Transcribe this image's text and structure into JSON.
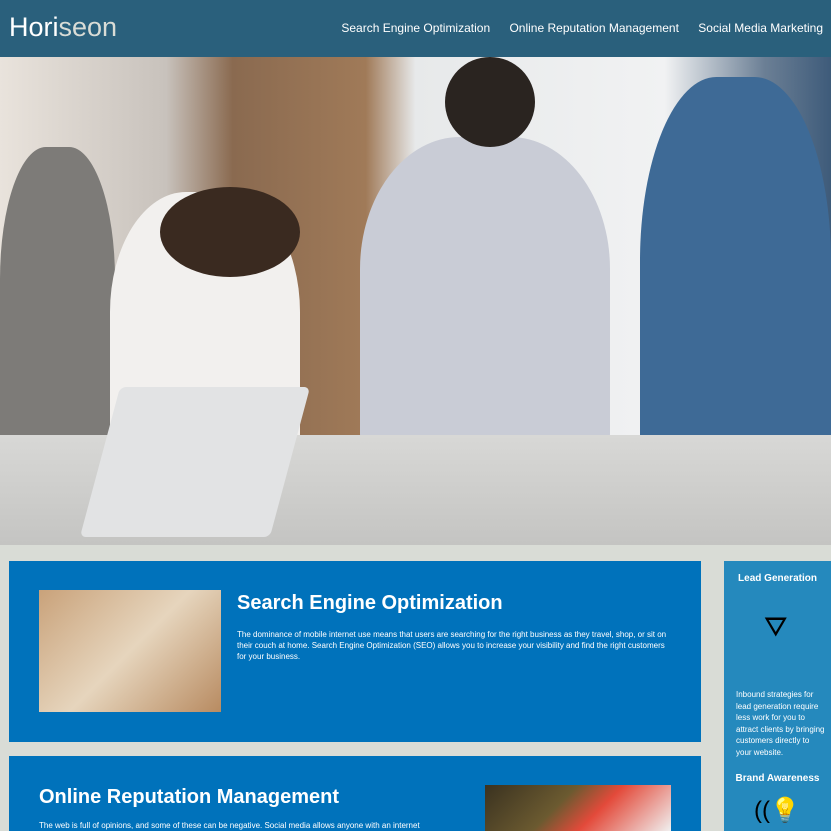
{
  "header": {
    "logo_main": "Hori",
    "logo_accent": "seon",
    "nav": [
      "Search Engine Optimization",
      "Online Reputation Management",
      "Social Media Marketing"
    ]
  },
  "hero": {
    "alt": "team meeting photo"
  },
  "content": [
    {
      "title": "Search Engine Optimization",
      "text": "The dominance of mobile internet use means that users are searching for the right business as they travel, shop, or sit on their couch at home. Search Engine Optimization (SEO) allows you to increase your visibility and find the right customers for your business."
    },
    {
      "title": "Online Reputation Management",
      "text": "The web is full of opinions, and some of these can be negative. Social media allows anyone with an internet"
    }
  ],
  "benefits": [
    {
      "title": "Lead Generation",
      "icon": "lead-funnel-icon",
      "text": "Inbound strategies for lead generation require less work for you to attract clients by bringing customers directly to your website."
    },
    {
      "title": "Brand Awareness",
      "icon": "lightbulb-broadcast-icon"
    }
  ],
  "colors": {
    "header": "#2a607c",
    "card": "#0072bb",
    "aside": "#2589bd",
    "background": "#d9dcd6"
  }
}
